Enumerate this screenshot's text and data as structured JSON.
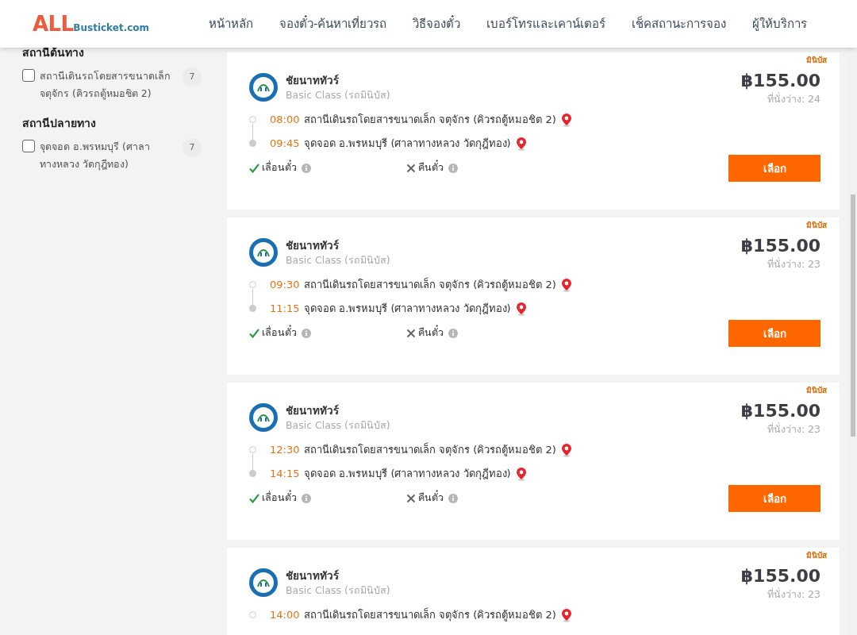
{
  "header": {
    "logo": {
      "part_1": "ALL",
      "part_2": "Busticket.com"
    },
    "nav": [
      {
        "label": "หน้าหลัก"
      },
      {
        "label": "จองตั๋ว-ค้นหาเที่ยวรถ"
      },
      {
        "label": "วิธีจองตั๋ว"
      },
      {
        "label": "เบอร์โทรและเคาน์เตอร์"
      },
      {
        "label": "เช็คสถานะการจอง"
      },
      {
        "label": "ผู้ให้บริการ"
      }
    ]
  },
  "sidebar": {
    "filters": [
      {
        "title": "สถานีต้นทาง",
        "options": [
          {
            "label": "สถานีเดินรถโดยสารขนาดเล็ก จตุจักร (คิวรถตู้หมอชิต 2)",
            "count": "7",
            "checked": false
          }
        ]
      },
      {
        "title": "สถานีปลายทาง",
        "options": [
          {
            "label": "จุดจอด อ.พรหมบุรี (ศาลาทางหลวง วัดกุฎีทอง)",
            "count": "7",
            "checked": false
          }
        ]
      }
    ]
  },
  "trips": [
    {
      "tag": "มินิบัส",
      "operator": "ชัยนาททัวร์",
      "class": "Basic Class (รถมินิบัส)",
      "price": "฿155.00",
      "seats": "ที่นั่งว่าง: 24",
      "stops": [
        {
          "kind": "origin",
          "time": "08:00",
          "place": "สถานีเดินรถโดยสารขนาดเล็ก จตุจักร (คิวรถตู้หมอชิต 2)"
        },
        {
          "kind": "destination",
          "time": "09:45",
          "place": "จุดจอด อ.พรหมบุรี (ศาลาทางหลวง วัดกุฎีทอง)"
        }
      ],
      "policies": [
        {
          "label": "เลื่อนตั๋ว",
          "allowed": true
        },
        {
          "label": "คืนตั๋ว",
          "allowed": false
        }
      ],
      "button": "เลือก"
    },
    {
      "tag": "มินิบัส",
      "operator": "ชัยนาททัวร์",
      "class": "Basic Class (รถมินิบัส)",
      "price": "฿155.00",
      "seats": "ที่นั่งว่าง: 23",
      "stops": [
        {
          "kind": "origin",
          "time": "09:30",
          "place": "สถานีเดินรถโดยสารขนาดเล็ก จตุจักร (คิวรถตู้หมอชิต 2)"
        },
        {
          "kind": "destination",
          "time": "11:15",
          "place": "จุดจอด อ.พรหมบุรี (ศาลาทางหลวง วัดกุฎีทอง)"
        }
      ],
      "policies": [
        {
          "label": "เลื่อนตั๋ว",
          "allowed": true
        },
        {
          "label": "คืนตั๋ว",
          "allowed": false
        }
      ],
      "button": "เลือก"
    },
    {
      "tag": "มินิบัส",
      "operator": "ชัยนาททัวร์",
      "class": "Basic Class (รถมินิบัส)",
      "price": "฿155.00",
      "seats": "ที่นั่งว่าง: 23",
      "stops": [
        {
          "kind": "origin",
          "time": "12:30",
          "place": "สถานีเดินรถโดยสารขนาดเล็ก จตุจักร (คิวรถตู้หมอชิต 2)"
        },
        {
          "kind": "destination",
          "time": "14:15",
          "place": "จุดจอด อ.พรหมบุรี (ศาลาทางหลวง วัดกุฎีทอง)"
        }
      ],
      "policies": [
        {
          "label": "เลื่อนตั๋ว",
          "allowed": true
        },
        {
          "label": "คืนตั๋ว",
          "allowed": false
        }
      ],
      "button": "เลือก"
    },
    {
      "tag": "มินิบัส",
      "operator": "ชัยนาททัวร์",
      "class": "Basic Class (รถมินิบัส)",
      "price": "฿155.00",
      "seats": "ที่นั่งว่าง: 23",
      "stops": [
        {
          "kind": "origin",
          "time": "14:00",
          "place": "สถานีเดินรถโดยสารขนาดเล็ก จตุจักร (คิวรถตู้หมอชิต 2)"
        }
      ]
    }
  ]
}
